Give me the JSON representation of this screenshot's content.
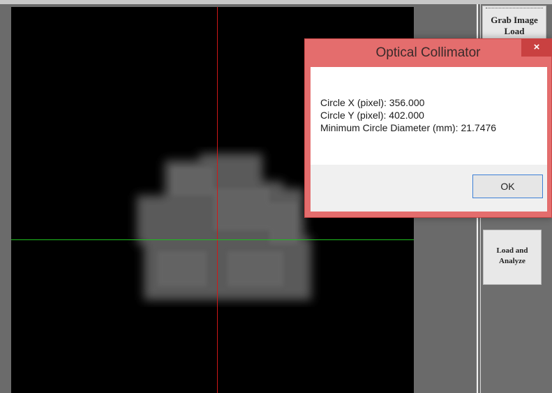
{
  "side_panel": {
    "grab_line1": "Grab Image",
    "grab_line2": "Load",
    "load_analyze_line1": "Load and",
    "load_analyze_line2": "Analyze"
  },
  "dialog": {
    "title": "Optical Collimator",
    "close_glyph": "×",
    "line1": "Circle X (pixel): 356.000",
    "line2": "Circle Y (pixel): 402.000",
    "line3": "Minimum Circle Diameter (mm): 21.7476",
    "ok_label": "OK"
  },
  "colors": {
    "crosshair_vertical": "#d01818",
    "crosshair_horizontal": "#1fbf1f",
    "dialog_frame": "#e46d6d",
    "close_button": "#c94141"
  },
  "icons": {
    "close": "close-icon"
  }
}
